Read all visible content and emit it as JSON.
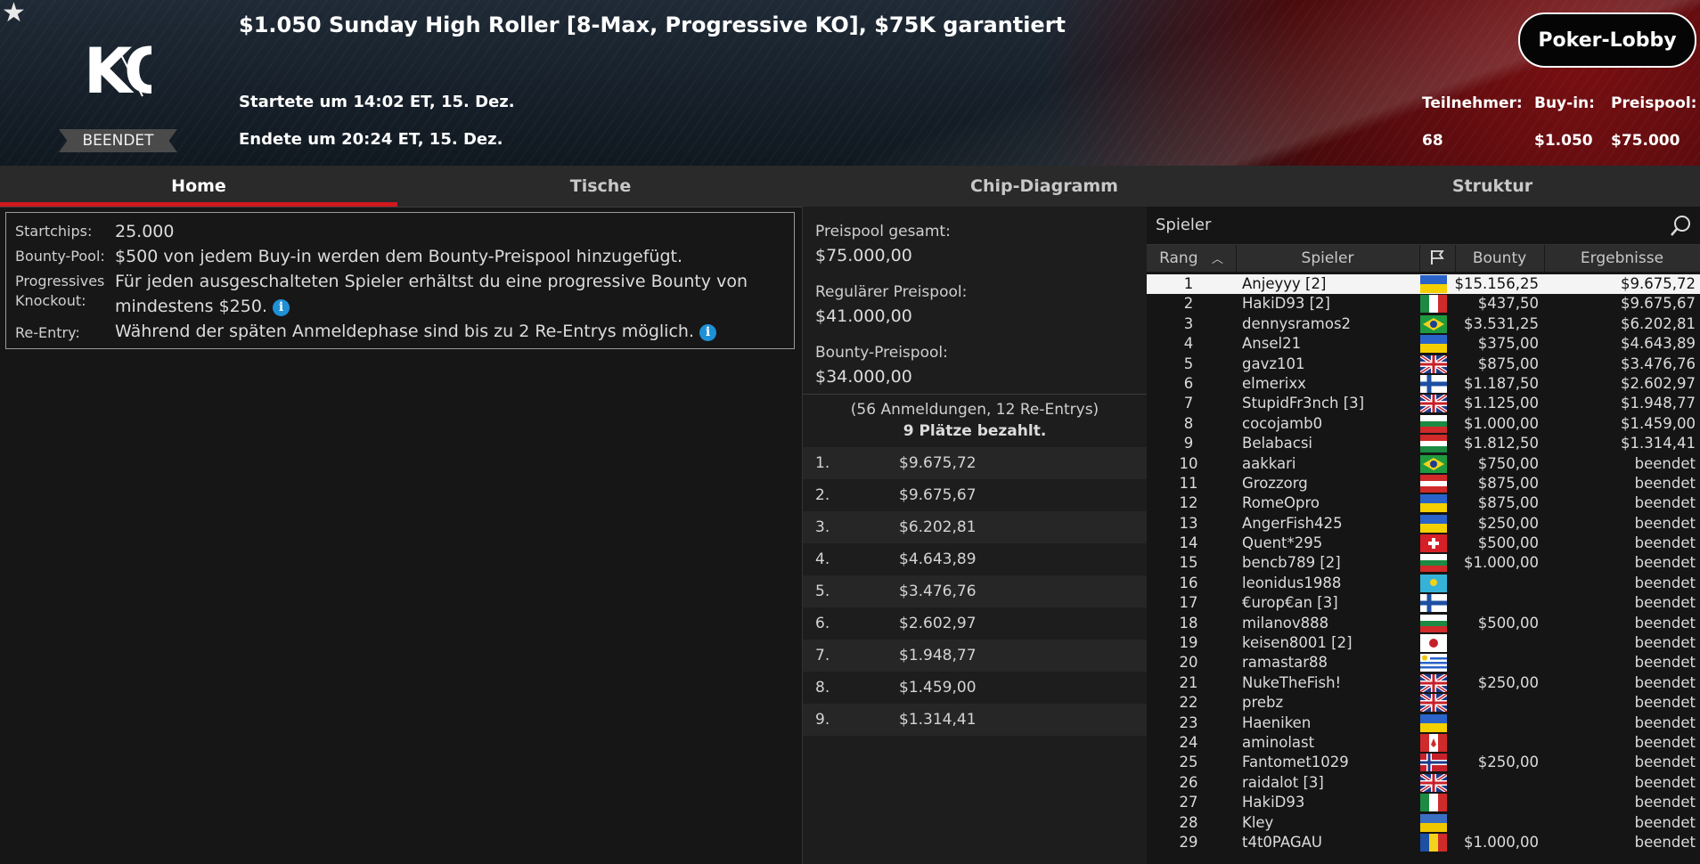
{
  "header": {
    "title": "$1.050 Sunday High Roller [8-Max, Progressive KO], $75K garantiert",
    "started": "Startete um 14:02 ET, 15. Dez.",
    "ended": "Endete um 20:24 ET, 15. Dez.",
    "status": "BEENDET",
    "lobby_button": "Poker-Lobby",
    "stats": {
      "participants_label": "Teilnehmer:",
      "participants_value": "68",
      "buyin_label": "Buy-in:",
      "buyin_value": "$1.050",
      "prizepool_label": "Preispool:",
      "prizepool_value": "$75.000"
    }
  },
  "tabs": [
    {
      "label": "Home"
    },
    {
      "label": "Tische"
    },
    {
      "label": "Chip-Diagramm"
    },
    {
      "label": "Struktur"
    }
  ],
  "info": {
    "startchips_label": "Startchips:",
    "startchips_value": "25.000",
    "bountypool_label": "Bounty-Pool:",
    "bountypool_value": "$500 von jedem Buy-in werden dem Bounty-Preispool hinzugefügt.",
    "pko_label_1": "Progressives",
    "pko_label_2": "Knockout:",
    "pko_value_1": "Für jeden ausgeschalteten Spieler erhältst du eine progressive Bounty von",
    "pko_value_2": "mindestens $250.",
    "reentry_label": "Re-Entry:",
    "reentry_value": "Während der späten Anmeldephase sind bis zu 2 Re-Entrys möglich.",
    "info_glyph": "i"
  },
  "prizes": {
    "total_label": "Preispool gesamt:",
    "total_value": "$75.000,00",
    "regular_label": "Regulärer Preispool:",
    "regular_value": "$41.000,00",
    "bounty_label": "Bounty-Preispool:",
    "bounty_value": "$34.000,00",
    "entries_text": "(56 Anmeldungen, 12 Re-Entrys)",
    "paid_text": "9 Plätze bezahlt.",
    "payouts": [
      {
        "rank": "1.",
        "amount": "$9.675,72"
      },
      {
        "rank": "2.",
        "amount": "$9.675,67"
      },
      {
        "rank": "3.",
        "amount": "$6.202,81"
      },
      {
        "rank": "4.",
        "amount": "$4.643,89"
      },
      {
        "rank": "5.",
        "amount": "$3.476,76"
      },
      {
        "rank": "6.",
        "amount": "$2.602,97"
      },
      {
        "rank": "7.",
        "amount": "$1.948,77"
      },
      {
        "rank": "8.",
        "amount": "$1.459,00"
      },
      {
        "rank": "9.",
        "amount": "$1.314,41"
      }
    ]
  },
  "players": {
    "search_label": "Spieler",
    "columns": {
      "rank": "Rang",
      "player": "Spieler",
      "bounty": "Bounty",
      "result": "Ergebnisse"
    },
    "rows": [
      {
        "rank": "1",
        "name": "Anjeyyy [2]",
        "flag": "ua",
        "bounty": "$15.156,25",
        "result": "$9.675,72"
      },
      {
        "rank": "2",
        "name": "HakiD93 [2]",
        "flag": "mx",
        "bounty": "$437,50",
        "result": "$9.675,67"
      },
      {
        "rank": "3",
        "name": "dennysramos2",
        "flag": "br",
        "bounty": "$3.531,25",
        "result": "$6.202,81"
      },
      {
        "rank": "4",
        "name": "Ansel21",
        "flag": "ua",
        "bounty": "$375,00",
        "result": "$4.643,89"
      },
      {
        "rank": "5",
        "name": "gavz101",
        "flag": "gb",
        "bounty": "$875,00",
        "result": "$3.476,76"
      },
      {
        "rank": "6",
        "name": "elmerixx",
        "flag": "fi",
        "bounty": "$1.187,50",
        "result": "$2.602,97"
      },
      {
        "rank": "7",
        "name": "StupidFr3nch [3]",
        "flag": "gb",
        "bounty": "$1.125,00",
        "result": "$1.948,77"
      },
      {
        "rank": "8",
        "name": "cocojamb0",
        "flag": "bg",
        "bounty": "$1.000,00",
        "result": "$1.459,00"
      },
      {
        "rank": "9",
        "name": "Belabacsi",
        "flag": "hu",
        "bounty": "$1.812,50",
        "result": "$1.314,41"
      },
      {
        "rank": "10",
        "name": "aakkari",
        "flag": "br",
        "bounty": "$750,00",
        "result": "beendet"
      },
      {
        "rank": "11",
        "name": "Grozzorg",
        "flag": "at",
        "bounty": "$875,00",
        "result": "beendet"
      },
      {
        "rank": "12",
        "name": "RomeOpro",
        "flag": "ua",
        "bounty": "$875,00",
        "result": "beendet"
      },
      {
        "rank": "13",
        "name": "AngerFish425",
        "flag": "ua",
        "bounty": "$250,00",
        "result": "beendet"
      },
      {
        "rank": "14",
        "name": "Quent*295",
        "flag": "ch",
        "bounty": "$500,00",
        "result": "beendet"
      },
      {
        "rank": "15",
        "name": "bencb789 [2]",
        "flag": "bg",
        "bounty": "$1.000,00",
        "result": "beendet"
      },
      {
        "rank": "16",
        "name": "leonidus1988",
        "flag": "kz",
        "bounty": "",
        "result": "beendet"
      },
      {
        "rank": "17",
        "name": "€urop€an [3]",
        "flag": "fi",
        "bounty": "",
        "result": "beendet"
      },
      {
        "rank": "18",
        "name": "milanov888",
        "flag": "bg",
        "bounty": "$500,00",
        "result": "beendet"
      },
      {
        "rank": "19",
        "name": "keisen8001 [2]",
        "flag": "jp",
        "bounty": "",
        "result": "beendet"
      },
      {
        "rank": "20",
        "name": "ramastar88",
        "flag": "uy",
        "bounty": "",
        "result": "beendet"
      },
      {
        "rank": "21",
        "name": "NukeTheFish!",
        "flag": "gb",
        "bounty": "$250,00",
        "result": "beendet"
      },
      {
        "rank": "22",
        "name": "prebz",
        "flag": "gb",
        "bounty": "",
        "result": "beendet"
      },
      {
        "rank": "23",
        "name": "Haeniken",
        "flag": "ua",
        "bounty": "",
        "result": "beendet"
      },
      {
        "rank": "24",
        "name": "aminolast",
        "flag": "ca",
        "bounty": "",
        "result": "beendet"
      },
      {
        "rank": "25",
        "name": "Fantomet1029",
        "flag": "no",
        "bounty": "$250,00",
        "result": "beendet"
      },
      {
        "rank": "26",
        "name": "raidalot [3]",
        "flag": "gb",
        "bounty": "",
        "result": "beendet"
      },
      {
        "rank": "27",
        "name": "HakiD93",
        "flag": "mx",
        "bounty": "",
        "result": "beendet"
      },
      {
        "rank": "28",
        "name": "Kley",
        "flag": "se",
        "bounty": "",
        "result": "beendet"
      },
      {
        "rank": "29",
        "name": "t4t0PAGAU",
        "flag": "md",
        "bounty": "$1.000,00",
        "result": "beendet"
      }
    ]
  },
  "colors": {
    "accent_red": "#d0181f",
    "info_blue": "#1e90d6",
    "background": "#161616"
  }
}
